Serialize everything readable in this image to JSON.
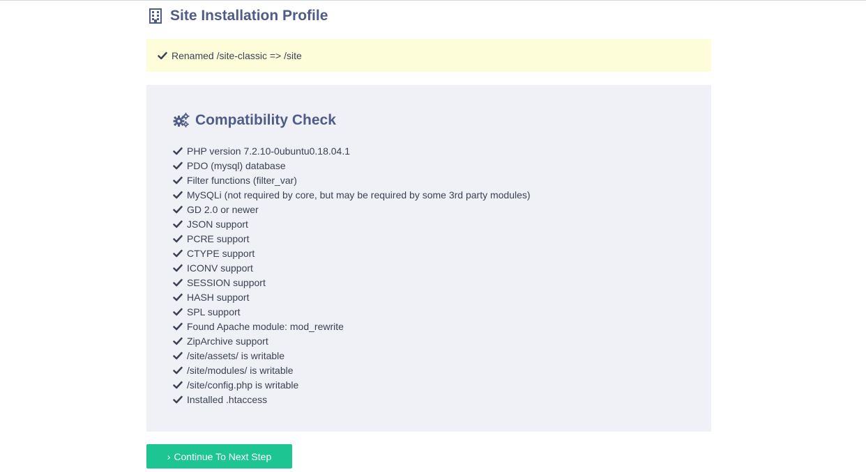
{
  "header": {
    "title": "Site Installation Profile",
    "icon": "building-icon"
  },
  "notice": {
    "text": "Renamed /site-classic => /site",
    "icon": "check-icon",
    "background": "#fdfed9"
  },
  "compatibility": {
    "title": "Compatibility Check",
    "icon": "gears-icon",
    "items": [
      "PHP version 7.2.10-0ubuntu0.18.04.1",
      "PDO (mysql) database",
      "Filter functions (filter_var)",
      "MySQLi (not required by core, but may be required by some 3rd party modules)",
      "GD 2.0 or newer",
      "JSON support",
      "PCRE support",
      "CTYPE support",
      "ICONV support",
      "SESSION support",
      "HASH support",
      "SPL support",
      "Found Apache module: mod_rewrite",
      "ZipArchive support",
      "/site/assets/ is writable",
      "/site/modules/ is writable",
      "/site/config.php is writable",
      "Installed .htaccess"
    ]
  },
  "actions": {
    "continue_label": "Continue To Next Step",
    "continue_icon": "chevron-right-icon",
    "accent": "#1dc592"
  },
  "colors": {
    "title": "#4e5c86",
    "panel": "#eff1f6",
    "text": "#3b4153"
  }
}
